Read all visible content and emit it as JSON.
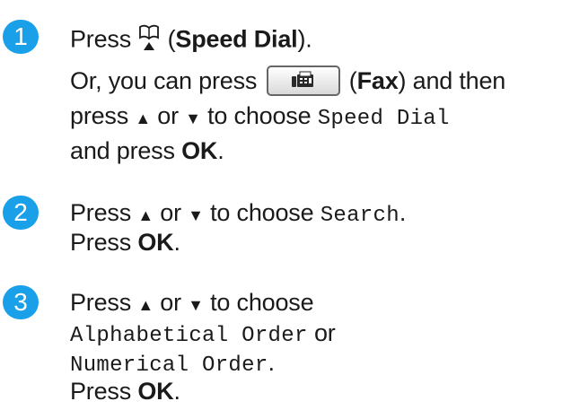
{
  "steps": [
    {
      "number": "1",
      "line1": {
        "prefix": "Press ",
        "mid": " (",
        "bold": "Speed Dial",
        "suffix": ")."
      },
      "line2": {
        "prefix": "Or, you can press ",
        "mid": " (",
        "bold": "Fax",
        "suffix": ") and then"
      },
      "line3": {
        "prefix": "press ",
        "up": "▲",
        "or": " or ",
        "down": "▼",
        "mid": " to choose ",
        "mono": "Speed Dial"
      },
      "line4": {
        "prefix": "and press ",
        "bold": "OK",
        "suffix": "."
      }
    },
    {
      "number": "2",
      "line1": {
        "prefix": "Press ",
        "up": "▲",
        "or": " or ",
        "down": "▼",
        "mid": " to choose ",
        "mono": "Search",
        "suffix": "."
      },
      "line2": {
        "prefix": "Press ",
        "bold": "OK",
        "suffix": "."
      }
    },
    {
      "number": "3",
      "line1": {
        "prefix": "Press ",
        "up": "▲",
        "or": " or ",
        "down": "▼",
        "mid": " to choose"
      },
      "line2": {
        "mono": "Alphabetical Order",
        "suffix": " or"
      },
      "line3": {
        "mono": "Numerical Order",
        "suffix": "."
      },
      "line4": {
        "prefix": "Press ",
        "bold": "OK",
        "suffix": "."
      }
    }
  ],
  "icons": {
    "speed_dial": "speed-dial-book-icon",
    "fax": "fax-machine-icon"
  },
  "colors": {
    "badge": "#1aa0e8",
    "text": "#1a1a1a"
  }
}
